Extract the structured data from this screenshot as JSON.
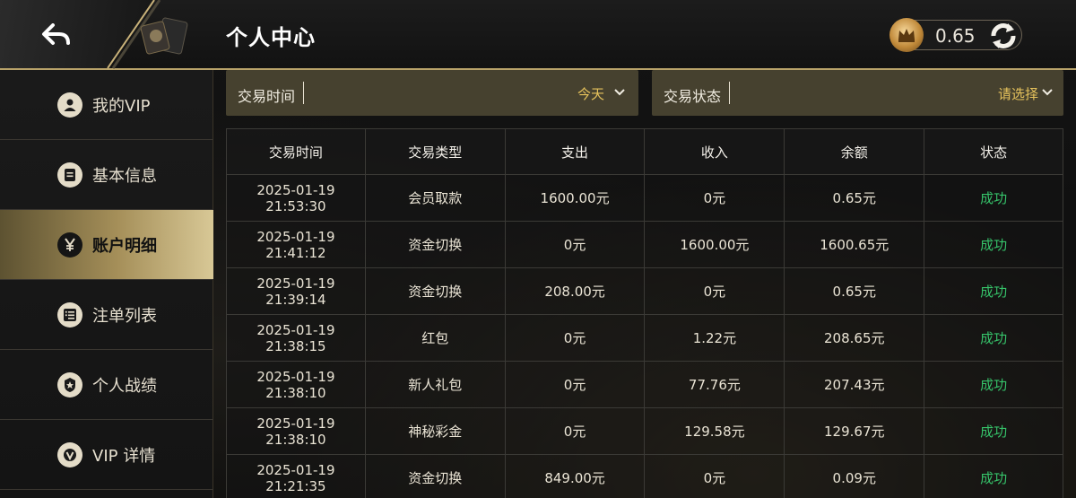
{
  "header": {
    "title": "个人中心",
    "balance": "0.65",
    "back_icon": "back-arrow-icon",
    "refresh_icon": "refresh-icon",
    "crown_icon": "crown-coin-icon"
  },
  "sidebar": {
    "items": [
      {
        "label": "我的VIP",
        "icon": "user-icon",
        "active": false
      },
      {
        "label": "基本信息",
        "icon": "document-icon",
        "active": false
      },
      {
        "label": "账户明细",
        "icon": "yen-icon",
        "active": true
      },
      {
        "label": "注单列表",
        "icon": "list-icon",
        "active": false
      },
      {
        "label": "个人战绩",
        "icon": "medal-icon",
        "active": false
      },
      {
        "label": "VIP 详情",
        "icon": "vip-badge-icon",
        "active": false
      }
    ]
  },
  "filters": {
    "time": {
      "label": "交易时间",
      "value": "今天"
    },
    "status": {
      "label": "交易状态",
      "value": "请选择"
    }
  },
  "table": {
    "headers": [
      "交易时间",
      "交易类型",
      "支出",
      "收入",
      "余额",
      "状态"
    ],
    "rows": [
      {
        "date": "2025-01-19",
        "time": "21:53:30",
        "type": "会员取款",
        "expense": "1600.00元",
        "income": "0元",
        "balance": "0.65元",
        "status": "成功"
      },
      {
        "date": "2025-01-19",
        "time": "21:41:12",
        "type": "资金切换",
        "expense": "0元",
        "income": "1600.00元",
        "balance": "1600.65元",
        "status": "成功"
      },
      {
        "date": "2025-01-19",
        "time": "21:39:14",
        "type": "资金切换",
        "expense": "208.00元",
        "income": "0元",
        "balance": "0.65元",
        "status": "成功"
      },
      {
        "date": "2025-01-19",
        "time": "21:38:15",
        "type": "红包",
        "expense": "0元",
        "income": "1.22元",
        "balance": "208.65元",
        "status": "成功"
      },
      {
        "date": "2025-01-19",
        "time": "21:38:10",
        "type": "新人礼包",
        "expense": "0元",
        "income": "77.76元",
        "balance": "207.43元",
        "status": "成功"
      },
      {
        "date": "2025-01-19",
        "time": "21:38:10",
        "type": "神秘彩金",
        "expense": "0元",
        "income": "129.58元",
        "balance": "129.67元",
        "status": "成功"
      },
      {
        "date": "2025-01-19",
        "time": "21:21:35",
        "type": "资金切换",
        "expense": "849.00元",
        "income": "0元",
        "balance": "0.09元",
        "status": "成功"
      }
    ]
  },
  "colors": {
    "accent_gold": "#b9a36a",
    "filter_bg": "#46412f",
    "filter_value": "#e6c25c",
    "status_success": "#36c36a"
  }
}
